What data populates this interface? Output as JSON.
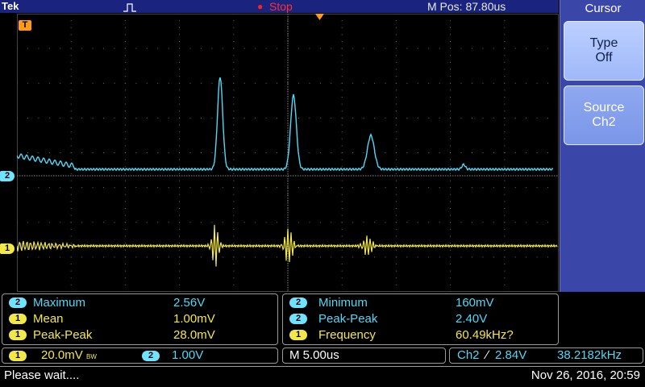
{
  "top": {
    "brand": "Tek",
    "run_status": "Stop",
    "mpos": "M Pos: 87.80us"
  },
  "markers": {
    "trigger_tag": "T",
    "ch2": "2",
    "ch1": "1"
  },
  "side_menu": {
    "title": "Cursor",
    "type_label": "Type",
    "type_value": "Off",
    "source_label": "Source",
    "source_value": "Ch2"
  },
  "measurements_left": [
    {
      "ch": "2",
      "name": "Maximum",
      "value": "2.56V"
    },
    {
      "ch": "1",
      "name": "Mean",
      "value": "1.00mV"
    },
    {
      "ch": "1",
      "name": "Peak-Peak",
      "value": "28.0mV"
    }
  ],
  "measurements_right": [
    {
      "ch": "2",
      "name": "Minimum",
      "value": "160mV"
    },
    {
      "ch": "2",
      "name": "Peak-Peak",
      "value": "2.40V"
    },
    {
      "ch": "1",
      "name": "Frequency",
      "value": "60.49kHz?"
    }
  ],
  "settings": {
    "ch1_num": "1",
    "ch1_scale": "20.0mV",
    "ch1_bw": "BW",
    "ch2_num": "2",
    "ch2_scale": "1.00V",
    "timebase": "M 5.00us",
    "trigger_source": "Ch2",
    "trigger_slope": "∕",
    "trigger_level": "2.84V",
    "trigger_freq": "38.2182kHz"
  },
  "status": {
    "message": "Please wait....",
    "datetime": "Nov 26, 2016, 20:59"
  },
  "colors": {
    "ch1": "#f2e84a",
    "ch2": "#52d8f5",
    "grid": "#6a6a6a",
    "menu_bg": "#3a46a8"
  }
}
